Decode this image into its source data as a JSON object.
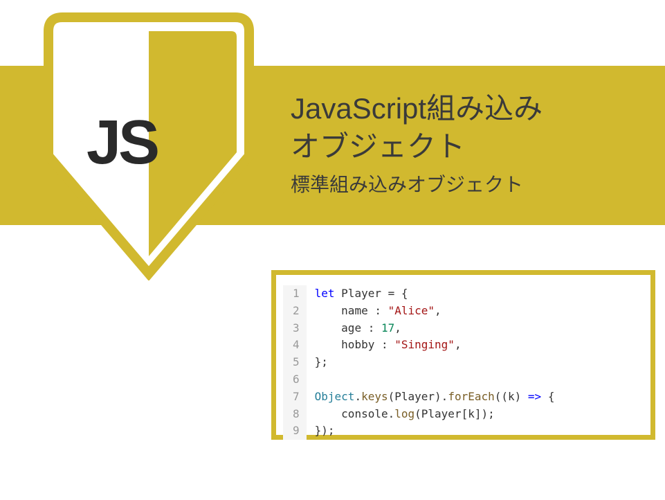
{
  "logo": {
    "text": "JS"
  },
  "title": {
    "line1": "JavaScript組み込み",
    "line2": "オブジェクト",
    "subtitle": "標準組み込みオブジェクト"
  },
  "code": {
    "lines": [
      {
        "n": "1",
        "tokens": [
          {
            "t": "let ",
            "c": "kw"
          },
          {
            "t": "Player = {",
            "c": "punct"
          }
        ]
      },
      {
        "n": "2",
        "tokens": [
          {
            "t": "    name : ",
            "c": "punct"
          },
          {
            "t": "\"Alice\"",
            "c": "str"
          },
          {
            "t": ",",
            "c": "punct"
          }
        ]
      },
      {
        "n": "3",
        "tokens": [
          {
            "t": "    age : ",
            "c": "punct"
          },
          {
            "t": "17",
            "c": "num"
          },
          {
            "t": ",",
            "c": "punct"
          }
        ]
      },
      {
        "n": "4",
        "tokens": [
          {
            "t": "    hobby : ",
            "c": "punct"
          },
          {
            "t": "\"Singing\"",
            "c": "str"
          },
          {
            "t": ",",
            "c": "punct"
          }
        ]
      },
      {
        "n": "5",
        "tokens": [
          {
            "t": "};",
            "c": "punct"
          }
        ]
      },
      {
        "n": "6",
        "tokens": [
          {
            "t": "",
            "c": "punct"
          }
        ]
      },
      {
        "n": "7",
        "tokens": [
          {
            "t": "Object",
            "c": "obj"
          },
          {
            "t": ".",
            "c": "punct"
          },
          {
            "t": "keys",
            "c": "fn"
          },
          {
            "t": "(Player).",
            "c": "punct"
          },
          {
            "t": "forEach",
            "c": "fn"
          },
          {
            "t": "((k) ",
            "c": "punct"
          },
          {
            "t": "=>",
            "c": "kw"
          },
          {
            "t": " {",
            "c": "punct"
          }
        ]
      },
      {
        "n": "8",
        "tokens": [
          {
            "t": "    console.",
            "c": "punct"
          },
          {
            "t": "log",
            "c": "fn"
          },
          {
            "t": "(Player[k]);",
            "c": "punct"
          }
        ]
      },
      {
        "n": "9",
        "tokens": [
          {
            "t": "});",
            "c": "punct"
          }
        ]
      }
    ]
  },
  "colors": {
    "accent": "#d1b92f"
  }
}
